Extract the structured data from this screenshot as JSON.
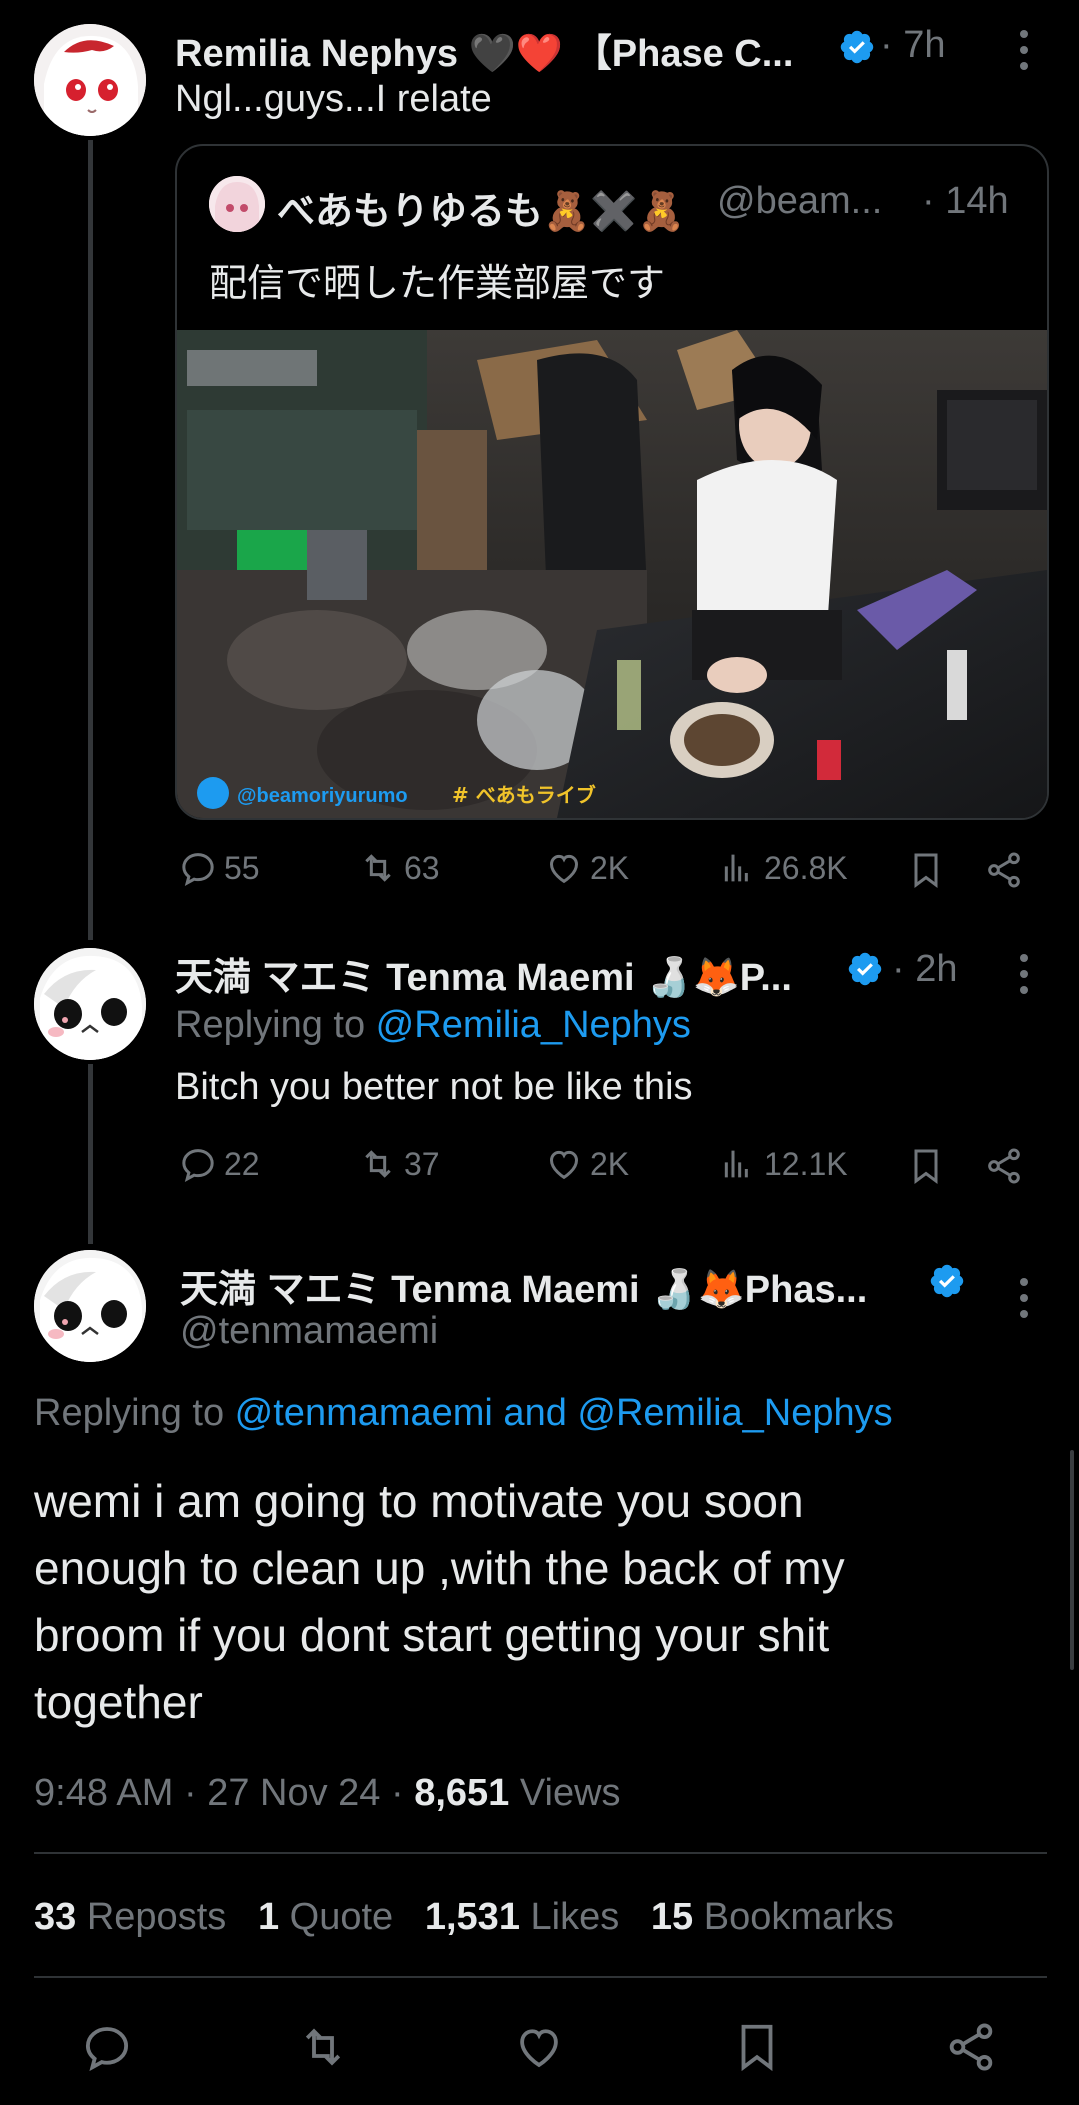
{
  "thread": {
    "tweet1": {
      "name": "Remilia Nephys",
      "emoji": "🖤❤️",
      "name_suffix": "【Phase C...",
      "time": "· 7h",
      "text": "Ngl...guys...I relate",
      "quote": {
        "name": "べあもりゆるも🧸✖️🧸",
        "handle": "@beam...",
        "time": "· 14h",
        "text": "配信で晒した作業部屋です",
        "watermark_handle": "@beamoriyurumo",
        "watermark_tag": "# べあもライブ"
      },
      "actions": {
        "replies": "55",
        "reposts": "63",
        "likes": "2K",
        "views": "26.8K"
      }
    },
    "tweet2": {
      "name": "天満 マエミ Tenma Maemi 🍶🦊P...",
      "time": "· 2h",
      "replying_prefix": "Replying to ",
      "replying_to": "@Remilia_Nephys",
      "text": "Bitch you better not be like this",
      "actions": {
        "replies": "22",
        "reposts": "37",
        "likes": "2K",
        "views": "12.1K"
      }
    }
  },
  "main_tweet": {
    "name": "天満 マエミ Tenma Maemi 🍶🦊Phas...",
    "handle": "@tenmamaemi",
    "replying_prefix": "Replying to ",
    "replying_to": "@tenmamaemi and @Remilia_Nephys",
    "text_lines": [
      "wemi i am going to motivate you soon",
      "enough to clean up ,with the back of my",
      "broom if you dont start getting your shit",
      "together"
    ],
    "meta": {
      "time": "9:48 AM",
      "date": "27 Nov 24",
      "views_count": "8,651",
      "views_label": "Views"
    },
    "stats": {
      "reposts_count": "33",
      "reposts_label": "Reposts",
      "quotes_count": "1",
      "quotes_label": "Quote",
      "likes_count": "1,531",
      "likes_label": "Likes",
      "bookmarks_count": "15",
      "bookmarks_label": "Bookmarks"
    }
  },
  "colors": {
    "accent": "#1d9bf0",
    "muted": "#71767b",
    "text": "#e7e9ea",
    "background": "#000000"
  },
  "icons": [
    "reply-icon",
    "repost-icon",
    "like-icon",
    "views-icon",
    "bookmark-icon",
    "share-icon",
    "verified-icon",
    "more-icon"
  ]
}
